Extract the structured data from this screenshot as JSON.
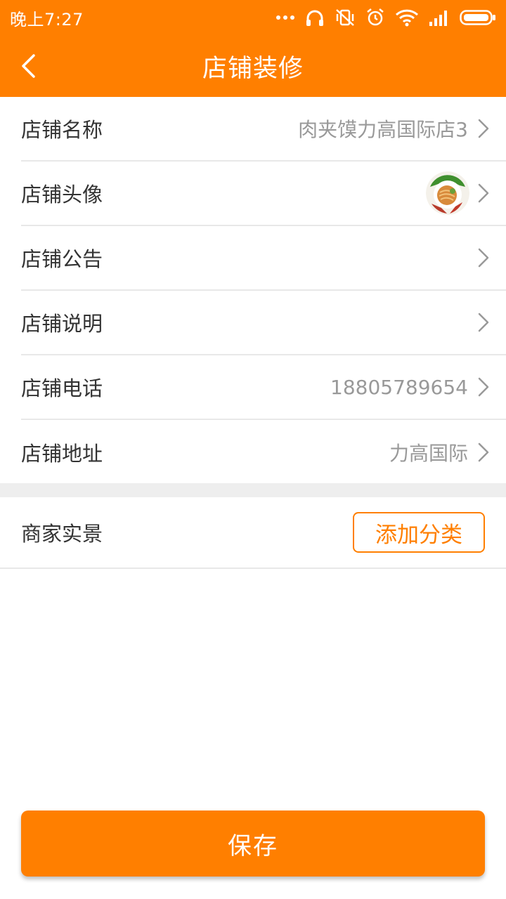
{
  "status_bar": {
    "time": "晚上7:27",
    "icons": [
      "more-dots-icon",
      "headphones-icon",
      "vibrate-off-icon",
      "alarm-icon",
      "wifi-icon",
      "signal-icon",
      "battery-icon"
    ]
  },
  "header": {
    "title": "店铺装修",
    "back_icon": "chevron-left-icon"
  },
  "settings": {
    "items": [
      {
        "label": "店铺名称",
        "value": "肉夹馍力高国际店3"
      },
      {
        "label": "店铺头像",
        "value": ""
      },
      {
        "label": "店铺公告",
        "value": ""
      },
      {
        "label": "店铺说明",
        "value": ""
      },
      {
        "label": "店铺电话",
        "value": "18805789654"
      },
      {
        "label": "店铺地址",
        "value": "力高国际"
      }
    ]
  },
  "scene": {
    "label": "商家实景",
    "add_button": "添加分类"
  },
  "footer": {
    "save_label": "保存"
  },
  "colors": {
    "accent": "#ff7f00",
    "divider": "#e8e8e8",
    "section_bg": "#eeeeee",
    "value_text": "#999999"
  }
}
